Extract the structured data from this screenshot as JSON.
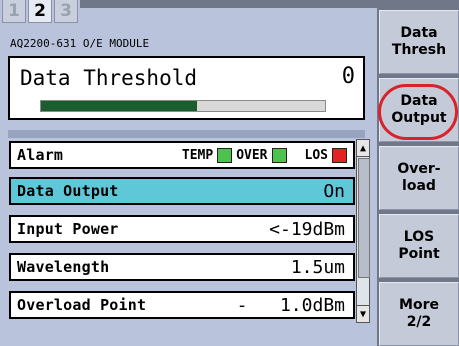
{
  "tabs": [
    {
      "label": "1",
      "active": false
    },
    {
      "label": "2",
      "active": true
    },
    {
      "label": "3",
      "active": false
    }
  ],
  "module_label": "AQ2200-631 O/E MODULE",
  "threshold": {
    "label": "Data Threshold",
    "value": "0",
    "bar_fraction": 0.55,
    "bar_color": "#1b5e2e"
  },
  "list": {
    "alarm": {
      "label": "Alarm",
      "items": [
        {
          "label": "TEMP",
          "state_color": "#4ec24e"
        },
        {
          "label": "OVER",
          "state_color": "#4ec24e"
        },
        {
          "label": "LOS",
          "state_color": "#e52222"
        }
      ]
    },
    "rows": [
      {
        "label": "Data Output",
        "value": "On",
        "selected": true
      },
      {
        "label": "Input Power",
        "value": "<-19dBm",
        "selected": false
      },
      {
        "label": "Wavelength",
        "value": "1.5um",
        "selected": false
      },
      {
        "label": "Overload Point",
        "value": "-   1.0dBm",
        "selected": false
      }
    ],
    "selected_color": "#5fc8d8"
  },
  "softkeys": [
    {
      "label": "Data\nThresh"
    },
    {
      "label": "Data\nOutput",
      "highlighted": true
    },
    {
      "label": "Over-\nload"
    },
    {
      "label": "LOS\nPoint"
    },
    {
      "label": "More\n2/2"
    }
  ],
  "scroll_icons": {
    "up": "triangle-up-icon",
    "down": "triangle-down-icon"
  }
}
